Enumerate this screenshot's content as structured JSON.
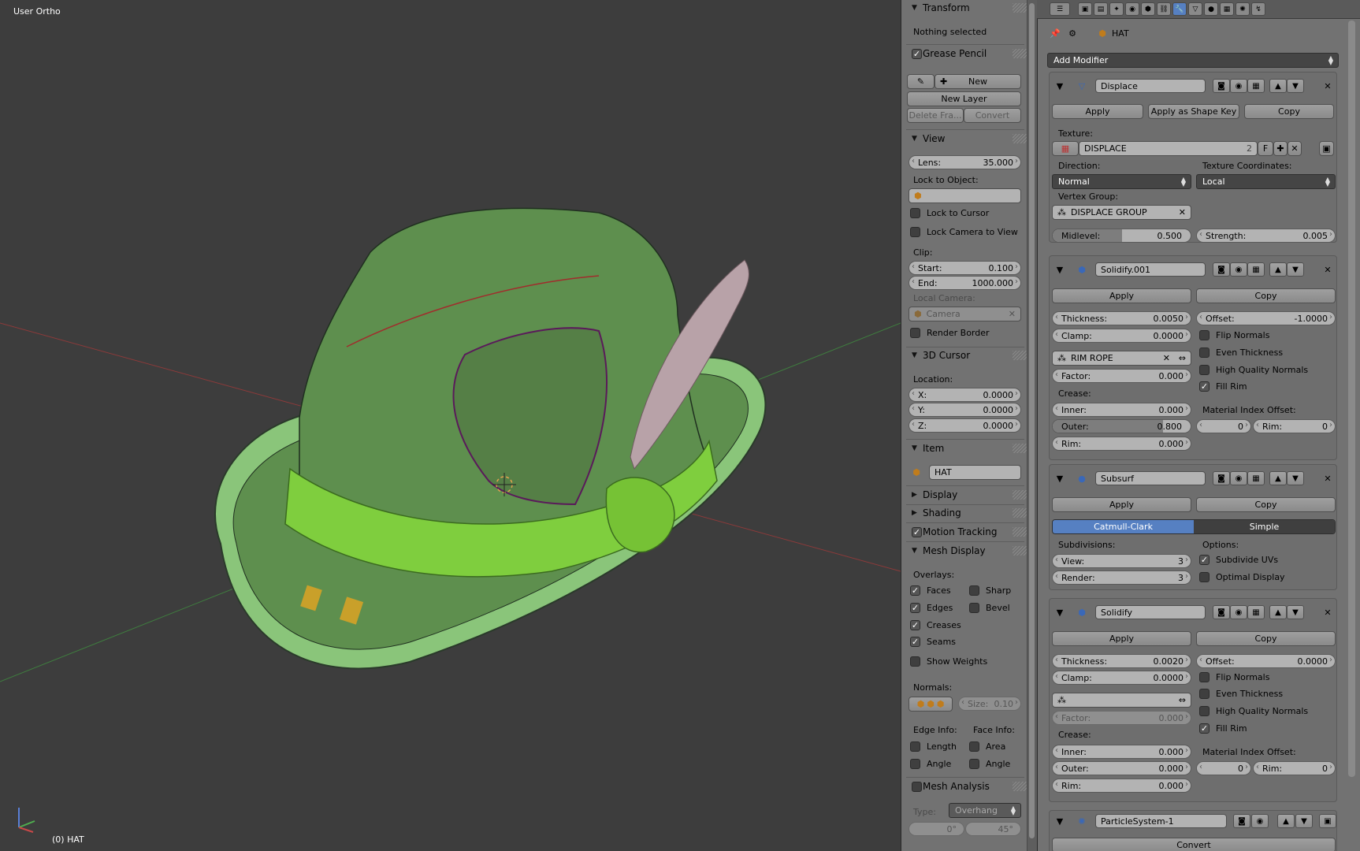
{
  "viewport": {
    "title": "User Ortho",
    "object_label": "(0) HAT",
    "colors": {
      "background": "#3d3d3d",
      "hat": "#5e8f4e",
      "band": "#7fce3e",
      "feather": "#b8a2a8"
    }
  },
  "npanel": {
    "transform": {
      "title": "Transform",
      "status": "Nothing selected"
    },
    "grease_pencil": {
      "title": "Grease Pencil",
      "new_label": "New",
      "new_layer_label": "New Layer",
      "delete_frame_label": "Delete Fra...",
      "convert_label": "Convert"
    },
    "view": {
      "title": "View",
      "lens_label": "Lens:",
      "lens_value": "35.000",
      "lock_to_object_label": "Lock to Object:",
      "lock_to_cursor_label": "Lock to Cursor",
      "lock_camera_label": "Lock Camera to View",
      "clip_label": "Clip:",
      "clip_start_label": "Start:",
      "clip_start_value": "0.100",
      "clip_end_label": "End:",
      "clip_end_value": "1000.000",
      "local_camera_label": "Local Camera:",
      "camera_placeholder": "Camera",
      "render_border_label": "Render Border"
    },
    "cursor": {
      "title": "3D Cursor",
      "location_label": "Location:",
      "x_label": "X:",
      "x_value": "0.0000",
      "y_label": "Y:",
      "y_value": "0.0000",
      "z_label": "Z:",
      "z_value": "0.0000"
    },
    "item": {
      "title": "Item",
      "name": "HAT"
    },
    "display_title": "Display",
    "shading_title": "Shading",
    "motion_tracking_title": "Motion Tracking",
    "mesh_display": {
      "title": "Mesh Display",
      "overlays_label": "Overlays:",
      "faces": "Faces",
      "sharp": "Sharp",
      "edges": "Edges",
      "bevel": "Bevel",
      "creases": "Creases",
      "seams": "Seams",
      "show_weights": "Show Weights",
      "normals_label": "Normals:",
      "size_label": "Size:",
      "size_value": "0.10",
      "edge_info_label": "Edge Info:",
      "face_info_label": "Face Info:",
      "length": "Length",
      "area": "Area",
      "angle_edge": "Angle",
      "angle_face": "Angle"
    },
    "mesh_analysis": {
      "title": "Mesh Analysis",
      "type_label": "Type:",
      "type_value": "Overhang",
      "min_value": "0°",
      "max_value": "45°"
    }
  },
  "properties": {
    "breadcrumb_object": "HAT",
    "add_modifier_label": "Add Modifier",
    "displace": {
      "name": "Displace",
      "apply": "Apply",
      "apply_shape": "Apply as Shape Key",
      "copy": "Copy",
      "texture_label": "Texture:",
      "texture_name": "DISPLACE",
      "texture_users": "2",
      "texture_fake": "F",
      "direction_label": "Direction:",
      "direction_value": "Normal",
      "texcoords_label": "Texture Coordinates:",
      "texcoords_value": "Local",
      "vgroup_label": "Vertex Group:",
      "vgroup_value": "DISPLACE GROUP",
      "midlevel_label": "Midlevel:",
      "midlevel_value": "0.500",
      "midlevel_fraction": 0.5,
      "strength_label": "Strength:",
      "strength_value": "0.005"
    },
    "solidify001": {
      "name": "Solidify.001",
      "apply": "Apply",
      "copy": "Copy",
      "thickness_label": "Thickness:",
      "thickness_value": "0.0050",
      "offset_label": "Offset:",
      "offset_value": "-1.0000",
      "clamp_label": "Clamp:",
      "clamp_value": "0.0000",
      "flip_normals": "Flip Normals",
      "even_thickness": "Even Thickness",
      "hq_normals": "High Quality Normals",
      "fill_rim": "Fill Rim",
      "vgroup_value": "RIM ROPE",
      "factor_label": "Factor:",
      "factor_value": "0.000",
      "crease_label": "Crease:",
      "inner_label": "Inner:",
      "inner_value": "0.000",
      "outer_label": "Outer:",
      "outer_value": "0.800",
      "outer_fraction": 0.8,
      "rim_label": "Rim:",
      "rim_value": "0.000",
      "mat_offset_label": "Material Index Offset:",
      "mat_offset_value": "0",
      "mat_rim_label": "Rim:",
      "mat_rim_value": "0"
    },
    "subsurf": {
      "name": "Subsurf",
      "apply": "Apply",
      "copy": "Copy",
      "catmull": "Catmull-Clark",
      "simple": "Simple",
      "subdivisions_label": "Subdivisions:",
      "options_label": "Options:",
      "view_label": "View:",
      "view_value": "3",
      "render_label": "Render:",
      "render_value": "3",
      "subdivide_uvs": "Subdivide UVs",
      "optimal_display": "Optimal Display"
    },
    "solidify": {
      "name": "Solidify",
      "apply": "Apply",
      "copy": "Copy",
      "thickness_label": "Thickness:",
      "thickness_value": "0.0020",
      "offset_label": "Offset:",
      "offset_value": "0.0000",
      "clamp_label": "Clamp:",
      "clamp_value": "0.0000",
      "flip_normals": "Flip Normals",
      "even_thickness": "Even Thickness",
      "hq_normals": "High Quality Normals",
      "fill_rim": "Fill Rim",
      "factor_label": "Factor:",
      "factor_value": "0.000",
      "crease_label": "Crease:",
      "inner_label": "Inner:",
      "inner_value": "0.000",
      "outer_label": "Outer:",
      "outer_value": "0.000",
      "rim_label": "Rim:",
      "rim_value": "0.000",
      "mat_offset_label": "Material Index Offset:",
      "mat_offset_value": "0",
      "mat_rim_label": "Rim:",
      "mat_rim_value": "0"
    },
    "particles": {
      "name": "ParticleSystem-1",
      "convert": "Convert"
    }
  }
}
